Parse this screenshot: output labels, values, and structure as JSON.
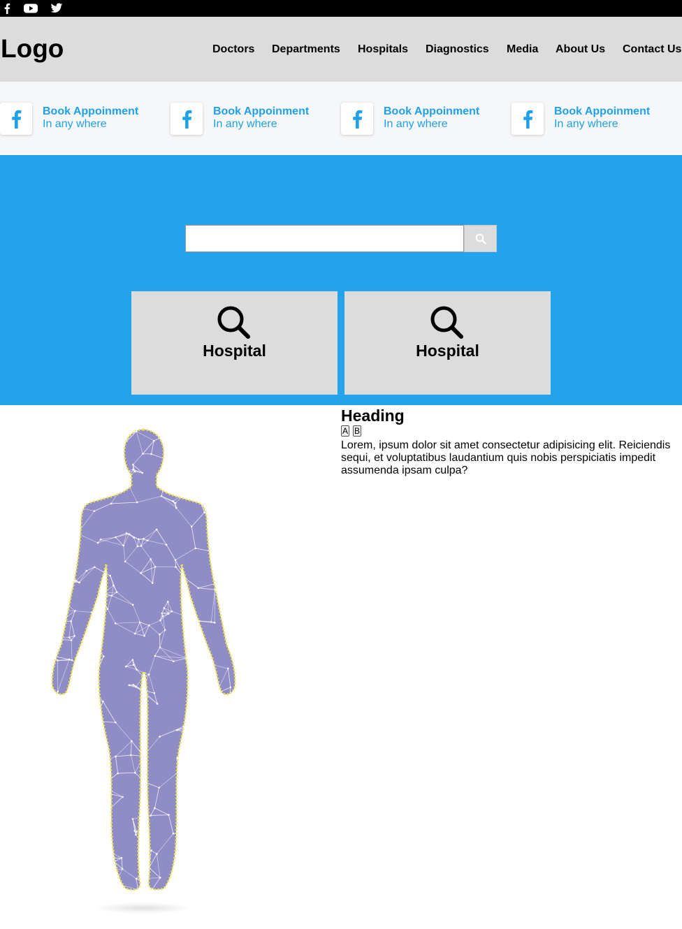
{
  "topbar": {
    "social_icons": [
      "facebook-icon",
      "youtube-icon",
      "twitter-icon"
    ]
  },
  "header": {
    "logo": "Logo",
    "nav": [
      "Doctors",
      "Departments",
      "Hospitals",
      "Diagnostics",
      "Media",
      "About Us",
      "Contact Us"
    ]
  },
  "booking_strip": {
    "items": [
      {
        "icon": "facebook-icon",
        "title": "Book Appoinment",
        "subtitle": "In any where"
      },
      {
        "icon": "facebook-icon",
        "title": "Book Appoinment",
        "subtitle": "In any where"
      },
      {
        "icon": "facebook-icon",
        "title": "Book Appoinment",
        "subtitle": "In any where"
      },
      {
        "icon": "facebook-icon",
        "title": "Book Appoinment",
        "subtitle": "In any where"
      }
    ]
  },
  "hero": {
    "search": {
      "value": "",
      "placeholder": "",
      "button_icon": "search-icon"
    },
    "cards": [
      {
        "icon": "search-icon",
        "label": "Hospital"
      },
      {
        "icon": "search-icon",
        "label": "Hospital"
      }
    ]
  },
  "content": {
    "heading": "Heading",
    "toggles": [
      "A",
      "B"
    ],
    "paragraph": "Lorem, ipsum dolor sit amet consectetur adipisicing elit. Reiciendis sequi, et voluptatibus laudantium quis nobis perspiciatis impedit assumenda ipsam culpa?"
  },
  "colors": {
    "topbar": "#000000",
    "header": "#dcdcdc",
    "strip": "#f6f7f9",
    "accent": "#1fa0e8",
    "hero": "#22a3ec",
    "card": "#dcdcdc",
    "body_figure": "#8f8cc6",
    "body_outline": "#f2e33a"
  }
}
